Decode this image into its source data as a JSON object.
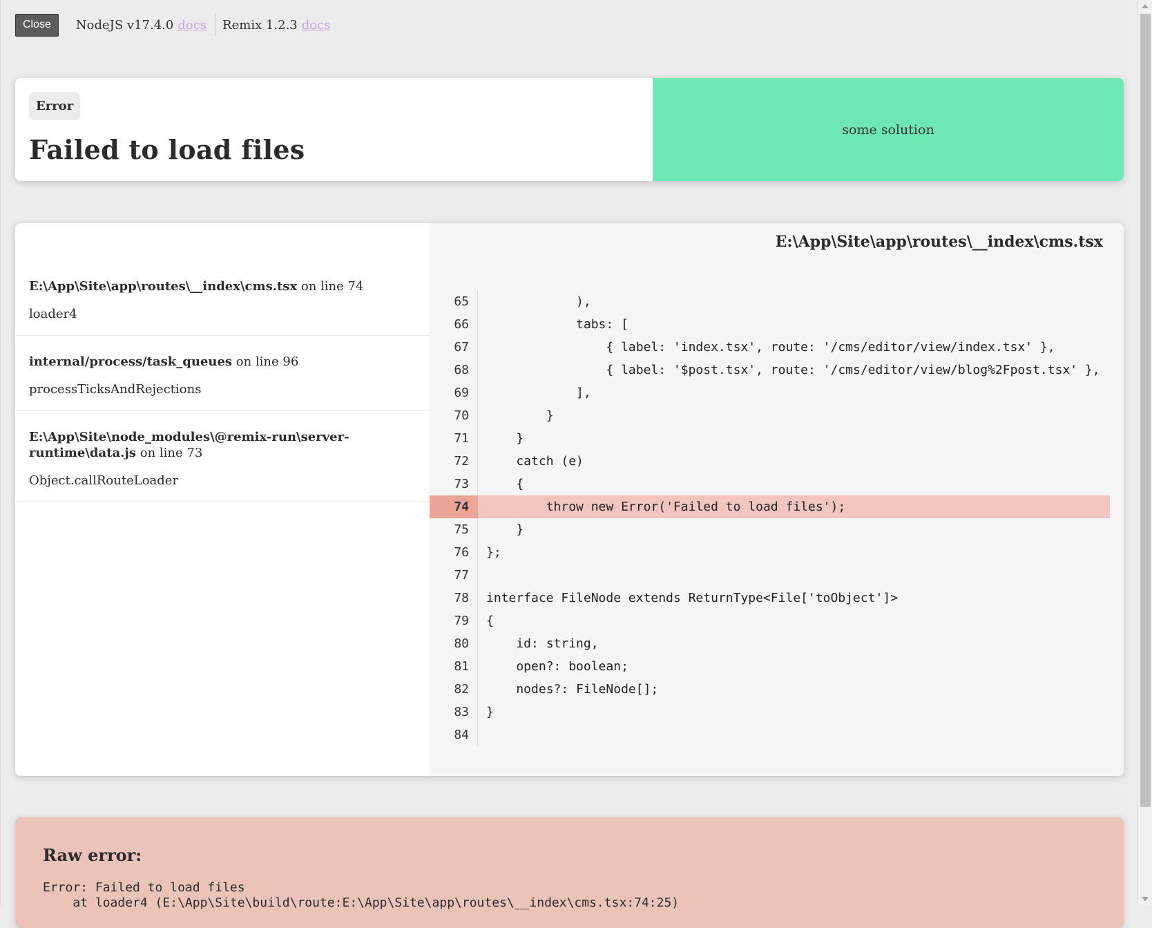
{
  "toolbar": {
    "close_label": "Close",
    "node_label": "NodeJS v17.4.0",
    "node_docs": "docs",
    "remix_label": "Remix 1.2.3",
    "remix_docs": "docs"
  },
  "error": {
    "badge": "Error",
    "title": "Failed to load files",
    "solution": "some solution"
  },
  "stack": {
    "frames": [
      {
        "file": "E:\\App\\Site\\app\\routes\\__index\\cms.tsx",
        "line_text": " on line 74",
        "function": "loader4"
      },
      {
        "file": "internal/process/task_queues",
        "line_text": " on line 96",
        "function": "processTicksAndRejections"
      },
      {
        "file": "E:\\App\\Site\\node_modules\\@remix-run\\server-runtime\\data.js",
        "line_text": " on line 73",
        "function": "Object.callRouteLoader"
      }
    ]
  },
  "code": {
    "file": "E:\\App\\Site\\app\\routes\\__index\\cms.tsx",
    "highlight_line": 74,
    "lines": [
      {
        "n": "65",
        "src": "            ),",
        "hl": false
      },
      {
        "n": "66",
        "src": "            tabs: [",
        "hl": false
      },
      {
        "n": "67",
        "src": "                { label: 'index.tsx', route: '/cms/editor/view/index.tsx' },",
        "hl": false
      },
      {
        "n": "68",
        "src": "                { label: '$post.tsx', route: '/cms/editor/view/blog%2Fpost.tsx' },",
        "hl": false
      },
      {
        "n": "69",
        "src": "            ],",
        "hl": false
      },
      {
        "n": "70",
        "src": "        }",
        "hl": false
      },
      {
        "n": "71",
        "src": "    }",
        "hl": false
      },
      {
        "n": "72",
        "src": "    catch (e)",
        "hl": false
      },
      {
        "n": "73",
        "src": "    {",
        "hl": false
      },
      {
        "n": "74",
        "src": "        throw new Error('Failed to load files');",
        "hl": true
      },
      {
        "n": "75",
        "src": "    }",
        "hl": false
      },
      {
        "n": "76",
        "src": "};",
        "hl": false
      },
      {
        "n": "77",
        "src": "",
        "hl": false
      },
      {
        "n": "78",
        "src": "interface FileNode extends ReturnType<File['toObject']>",
        "hl": false
      },
      {
        "n": "79",
        "src": "{",
        "hl": false
      },
      {
        "n": "80",
        "src": "    id: string,",
        "hl": false
      },
      {
        "n": "81",
        "src": "    open?: boolean;",
        "hl": false
      },
      {
        "n": "82",
        "src": "    nodes?: FileNode[];",
        "hl": false
      },
      {
        "n": "83",
        "src": "}",
        "hl": false
      },
      {
        "n": "84",
        "src": "",
        "hl": false
      }
    ]
  },
  "raw": {
    "title": "Raw error:",
    "line1": "Error: Failed to load files",
    "line2": "    at loader4 (E:\\App\\Site\\build\\route:E:\\App\\Site\\app\\routes\\__index\\cms.tsx:74:25)"
  },
  "scrollbar": {
    "up_icon": "chevron-up-icon",
    "down_icon": "chevron-down-icon"
  }
}
